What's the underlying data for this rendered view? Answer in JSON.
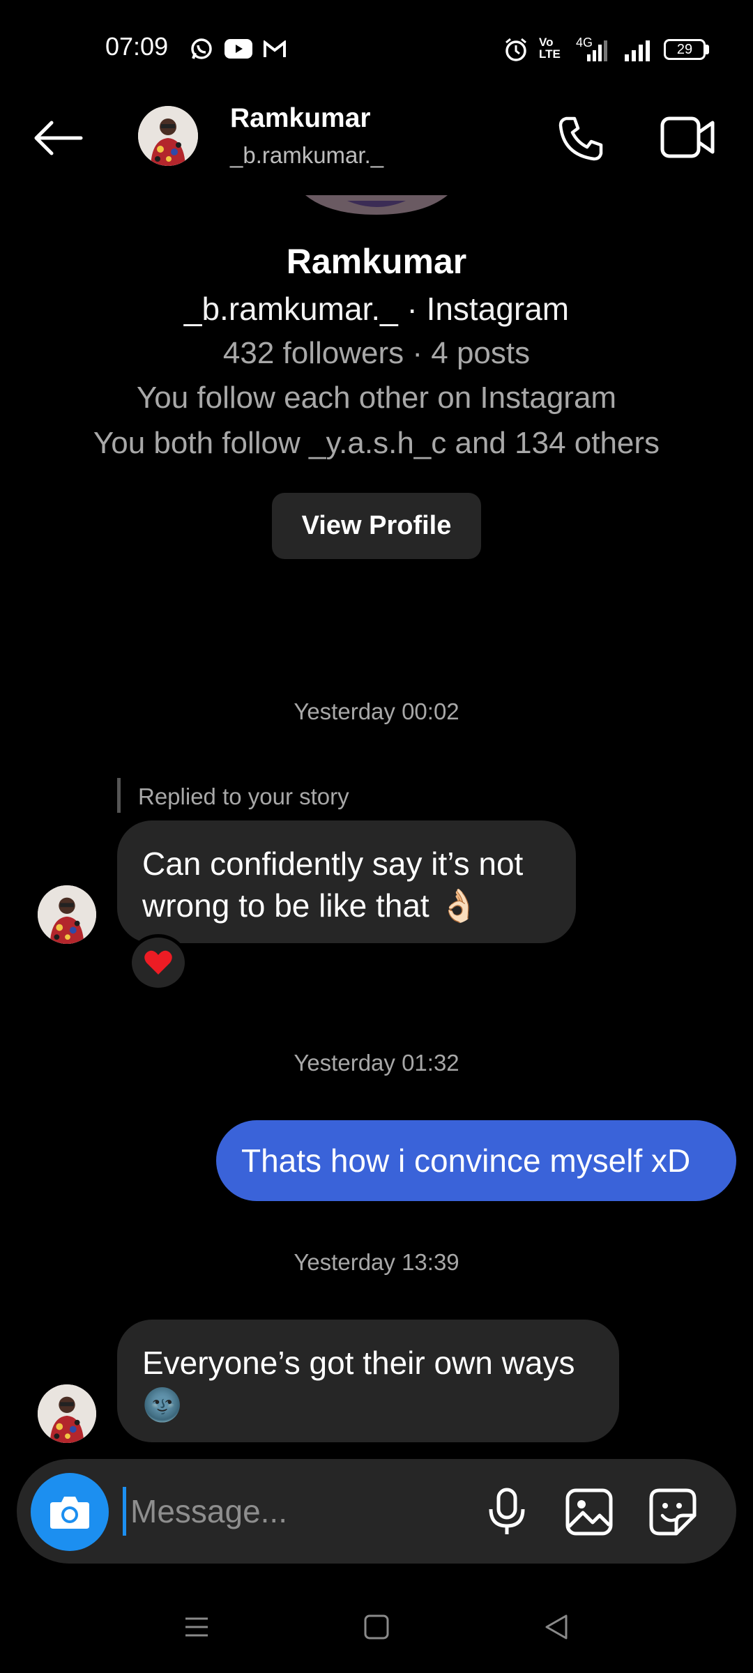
{
  "status_bar": {
    "time": "07:09",
    "battery": "29",
    "network": "4G",
    "volte": "Vo LTE",
    "icons": [
      "whatsapp-icon",
      "youtube-icon",
      "gmail-icon",
      "alarm-icon",
      "signal-icon",
      "battery-icon"
    ]
  },
  "header": {
    "name": "Ramkumar",
    "username": "_b.ramkumar._"
  },
  "profile_card": {
    "name": "Ramkumar",
    "handle_line": "_b.ramkumar._ · Instagram",
    "stats": "432 followers · 4 posts",
    "follow_status": "You follow each other on Instagram",
    "mutual": "You both follow _y.a.s.h_c and 134 others",
    "view_profile_label": "View Profile"
  },
  "messages": [
    {
      "timestamp": "Yesterday 00:02"
    },
    {
      "reply_label": "Replied to your story",
      "text": "Can confidently say it’s not wrong to be like that 👌🏻",
      "line1": "Can confidently say it’s not",
      "line2": "wrong to be like that",
      "reaction": "❤️"
    },
    {
      "timestamp": "Yesterday 01:32"
    },
    {
      "text": "Thats how i convince myself xD"
    },
    {
      "timestamp": "Yesterday 13:39"
    },
    {
      "text": "Everyone’s got their own ways 🌚",
      "line1": "Everyone’s got their own ways"
    }
  ],
  "composer": {
    "placeholder": "Message..."
  },
  "colors": {
    "background": "#000000",
    "incoming_bubble": "#262626",
    "outgoing_bubble": "#3a63d9",
    "accent": "#1c8ff0",
    "muted_text": "#a8a8a8"
  }
}
